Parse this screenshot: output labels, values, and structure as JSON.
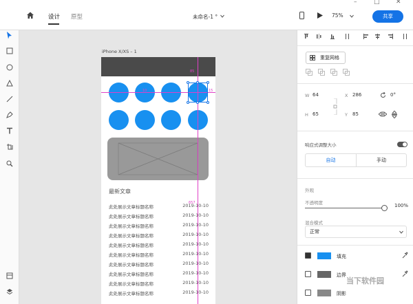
{
  "header": {
    "tabs": [
      {
        "label": "设计",
        "active": true
      },
      {
        "label": "原型",
        "active": false
      }
    ],
    "doc_title": "未命名-1 °",
    "zoom": "75%",
    "share_label": "共享"
  },
  "window_controls": {
    "minimize": "–",
    "maximize": "□",
    "close": "✕"
  },
  "tools": [
    "select-tool",
    "rectangle-tool",
    "ellipse-tool",
    "polygon-tool",
    "line-tool",
    "pen-tool",
    "text-tool",
    "artboard-tool",
    "zoom-tool",
    "assets-panel",
    "layers-panel"
  ],
  "artboard": {
    "label": "iPhone X/XS – 1",
    "section_title": "最新文章",
    "rows": [
      {
        "title": "此处展示文章标题名称",
        "date": "2019-10-10"
      },
      {
        "title": "此处展示文章标题名称",
        "date": "2019-10-10"
      },
      {
        "title": "此处展示文章标题名称",
        "date": "2019-10-10"
      },
      {
        "title": "此处展示文章标题名称",
        "date": "2019-10-10"
      },
      {
        "title": "此处展示文章标题名称",
        "date": "2019-10-10"
      },
      {
        "title": "此处展示文章标题名称",
        "date": "2019-10-10"
      },
      {
        "title": "此处展示文章标题名称",
        "date": "2019-10-10"
      },
      {
        "title": "此处展示文章标题名称",
        "date": "2019-10-10"
      },
      {
        "title": "此处展示文章标题名称",
        "date": "2019-10-10"
      },
      {
        "title": "此处展示文章标题名称",
        "date": "2019-10-10"
      }
    ],
    "circle_color": "#1890f0",
    "measures": {
      "top": "85",
      "left": "10",
      "right": "15",
      "bottom": "657"
    }
  },
  "panel": {
    "repeat_grid_label": "重复网格",
    "w_label": "W",
    "w_value": "64",
    "x_label": "X",
    "x_value": "286",
    "rotation": "0°",
    "h_label": "H",
    "h_value": "65",
    "y_label": "Y",
    "y_value": "85",
    "responsive_label": "响应式调整大小",
    "auto_label": "自动",
    "manual_label": "手动",
    "appearance_label": "外观",
    "opacity_label": "不透明度",
    "opacity_value": "100%",
    "blend_label": "混合模式",
    "blend_value": "正常",
    "fill_label": "填充",
    "fill_color": "#1890f0",
    "border_label": "边界",
    "shadow_label": "阴影"
  },
  "watermark": "当下软件园",
  "accent_color": "#1473e6"
}
